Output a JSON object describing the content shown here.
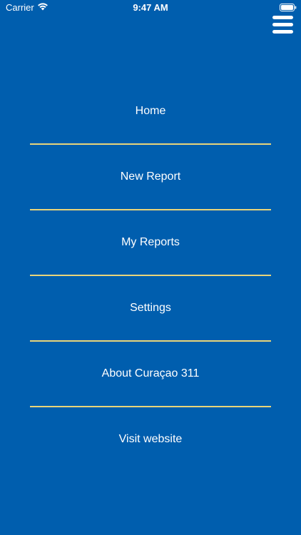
{
  "status_bar": {
    "carrier": "Carrier",
    "time": "9:47 AM",
    "wifi_icon": "wifi-icon",
    "battery_icon": "battery-icon"
  },
  "header": {
    "menu_icon": "hamburger-menu-icon"
  },
  "menu": {
    "items": [
      {
        "label": "Home"
      },
      {
        "label": "New Report"
      },
      {
        "label": "My Reports"
      },
      {
        "label": "Settings"
      },
      {
        "label": "About Curaçao 311"
      },
      {
        "label": "Visit website"
      }
    ]
  },
  "colors": {
    "background": "#005eae",
    "divider": "#e9d57a",
    "text": "#ffffff"
  }
}
